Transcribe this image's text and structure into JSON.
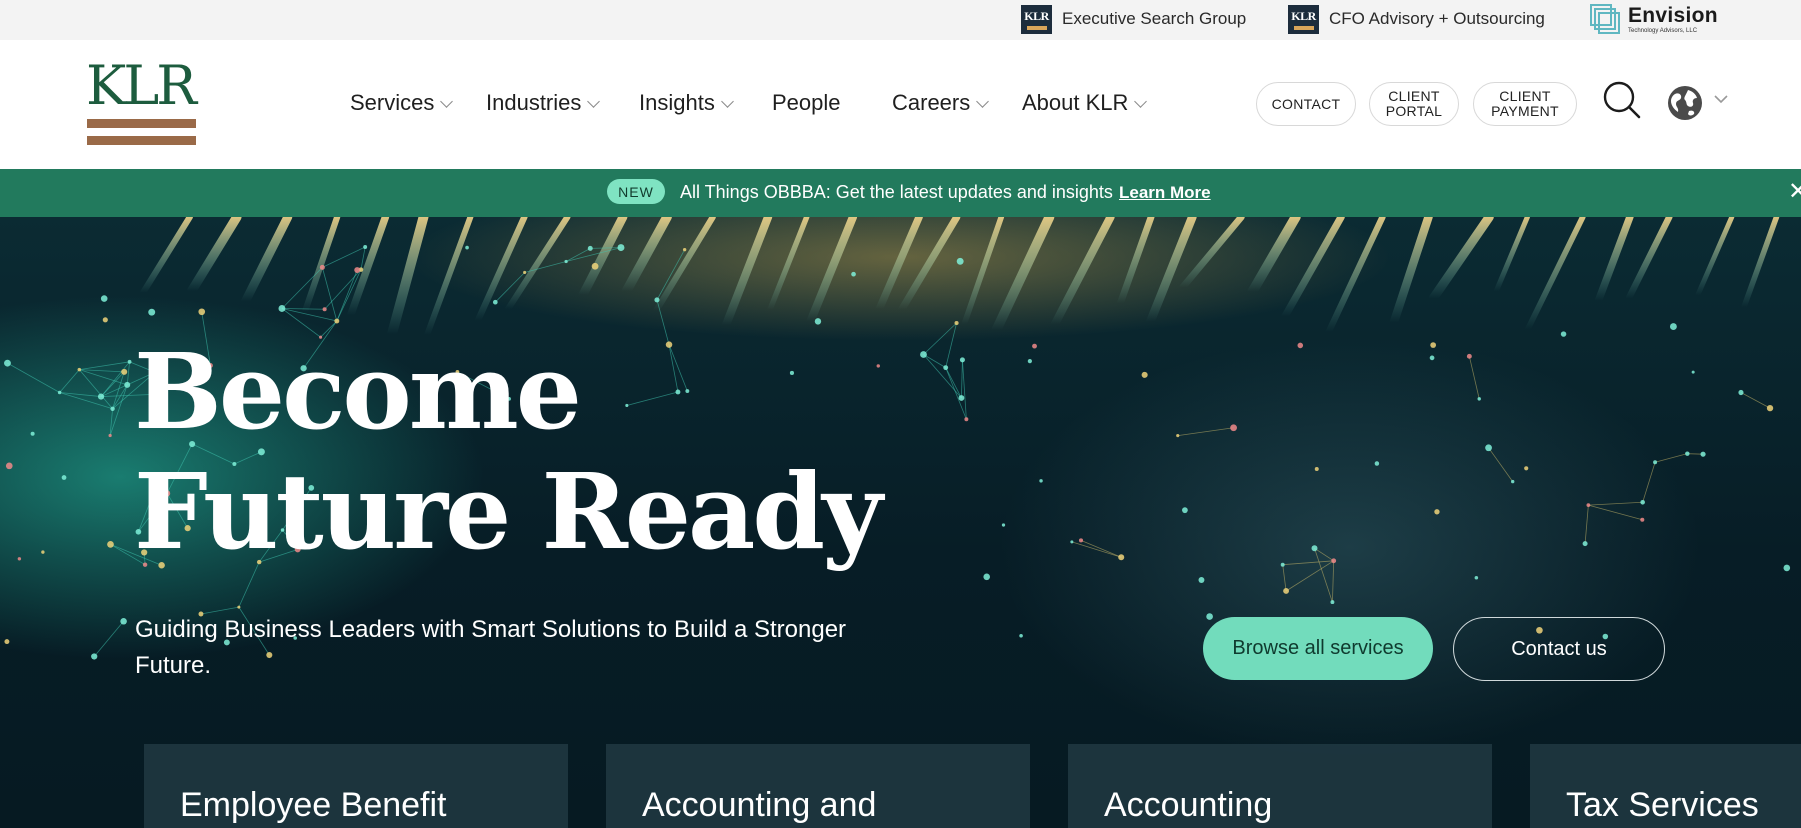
{
  "utility": {
    "links": [
      {
        "logo_text": "KLR",
        "label": "Executive Search Group"
      },
      {
        "logo_text": "KLR",
        "label": "CFO Advisory + Outsourcing"
      }
    ],
    "envision": {
      "name": "Envision",
      "tagline": "Technology Advisors, LLC"
    }
  },
  "header": {
    "logo_text": "KLR",
    "nav": [
      {
        "label": "Services",
        "dropdown": true
      },
      {
        "label": "Industries",
        "dropdown": true
      },
      {
        "label": "Insights",
        "dropdown": true
      },
      {
        "label": "People",
        "dropdown": false
      },
      {
        "label": "Careers",
        "dropdown": true
      },
      {
        "label": "About KLR",
        "dropdown": true
      }
    ],
    "pills": {
      "contact": "CONTACT",
      "portal_line1": "CLIENT",
      "portal_line2": "PORTAL",
      "payment_line1": "CLIENT",
      "payment_line2": "PAYMENT"
    },
    "icons": [
      "search-icon",
      "globe-icon",
      "chevron-down-icon"
    ]
  },
  "announcement": {
    "badge": "NEW",
    "text": "All Things OBBBA: Get the latest updates and insights",
    "link": "Learn More",
    "close": "✕"
  },
  "hero": {
    "title_line1": "Become",
    "title_line2": "Future Ready",
    "subtitle": "Guiding Business Leaders with Smart Solutions to Build a Stronger Future.",
    "primary_button": "Browse all services",
    "secondary_button": "Contact us"
  },
  "service_cards": [
    {
      "title": "Employee Benefit"
    },
    {
      "title": "Accounting and"
    },
    {
      "title": "Accounting"
    },
    {
      "title": "Tax Services"
    }
  ],
  "colors": {
    "brand_green": "#1d5c3e",
    "logo_bar": "#9a6a48",
    "announcement_bg": "#227a5d",
    "badge_bg": "#7fe3c2",
    "cta_bg": "#72dcbc",
    "hero_bg": "#071d26"
  }
}
